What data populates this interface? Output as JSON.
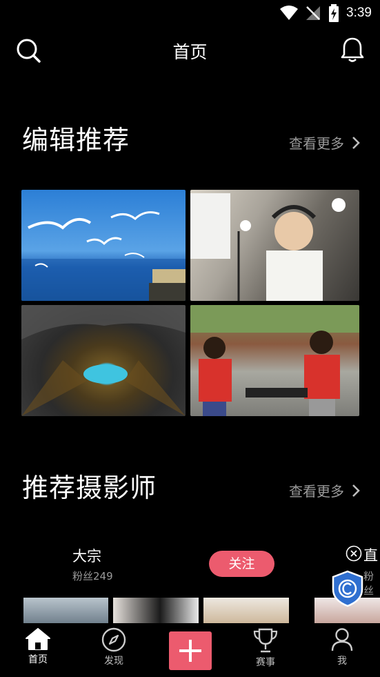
{
  "status_bar": {
    "time": "3:39"
  },
  "header": {
    "title": "首页"
  },
  "sections": {
    "editor_picks": {
      "title": "编辑推荐",
      "more": "查看更多"
    },
    "photographers": {
      "title": "推荐摄影师",
      "more": "查看更多"
    }
  },
  "photographer_cards": [
    {
      "name": "大宗",
      "fans": "粉丝249",
      "follow": "关注"
    },
    {
      "name": "直",
      "fans": "粉丝"
    }
  ],
  "tabs": [
    {
      "label": "首页",
      "icon": "home-icon",
      "active": true
    },
    {
      "label": "发现",
      "icon": "compass-icon",
      "active": false
    },
    {
      "label": "",
      "icon": "plus-icon",
      "active": false
    },
    {
      "label": "赛事",
      "icon": "trophy-icon",
      "active": false
    },
    {
      "label": "我",
      "icon": "person-icon",
      "active": false
    }
  ],
  "colors": {
    "accent": "#ec5b6e",
    "background": "#000000",
    "muted_text": "#9a9a9a"
  }
}
